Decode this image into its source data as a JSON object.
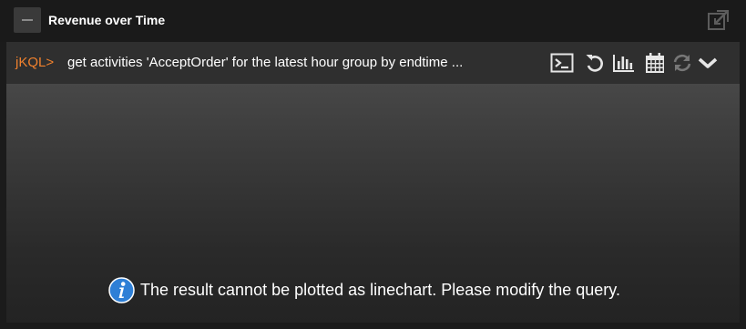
{
  "widget": {
    "title": "Revenue over Time",
    "collapse_icon": "minus-icon",
    "popout_icon": "popout-icon"
  },
  "query": {
    "prompt": "jKQL>",
    "text": "get activities 'AcceptOrder' for the latest hour group by endtime ...",
    "toolbar": [
      {
        "name": "console-icon"
      },
      {
        "name": "undo-icon"
      },
      {
        "name": "bar-chart-icon"
      },
      {
        "name": "calendar-icon"
      },
      {
        "name": "refresh-icon"
      },
      {
        "name": "chevron-down-icon"
      }
    ]
  },
  "plot": {
    "message": "The result cannot be plotted as linechart. Please modify the query.",
    "message_icon": "info-icon"
  },
  "colors": {
    "prompt": "#f0812d",
    "info": "#2e7fd6",
    "icon": "#e6e6e6",
    "icon_disabled": "#777777"
  }
}
